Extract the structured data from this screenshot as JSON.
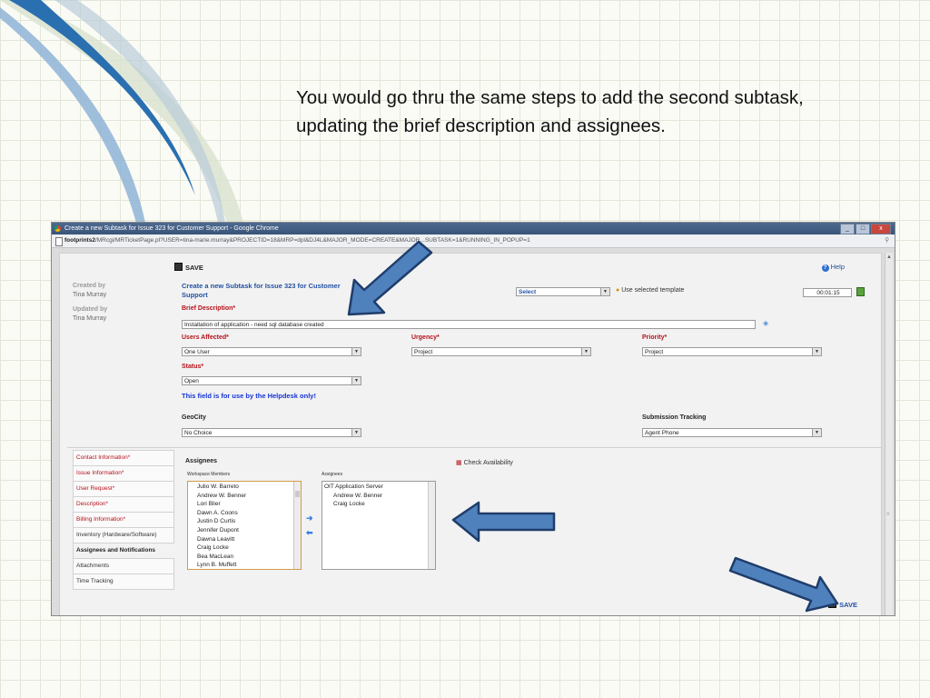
{
  "caption": "You would go thru the same steps to add the second subtask, updating the brief description and assignees.",
  "window": {
    "title": "Create a new Subtask for Issue 323 for Customer Support - Google Chrome",
    "url_host": "footprints2",
    "url_path": "/MRcgi/MRTicketPage.pl?USER=tina-marie.murray&PROJECTID=18&MRP=dpl&DJ4L&MAJOR_MODE=CREATE&MAJOR...SUBTASK=1&RUNNING_IN_POPUP=1",
    "buttons": [
      "_",
      "□",
      "x"
    ]
  },
  "toolbar": {
    "save_label": "SAVE",
    "help_label": "Help"
  },
  "meta": {
    "created_by_label": "Created by",
    "created_by": "Tina Murray",
    "updated_by_label": "Updated by",
    "updated_by": "Tina Murray"
  },
  "form": {
    "title": "Create a new Subtask for Issue 323 for Customer Support",
    "template_select": "Select",
    "use_template_label": "Use selected template",
    "timer": "00:01:15",
    "brief_description_label": "Brief Description*",
    "brief_description": "Installation of application - need sql database created",
    "users_affected_label": "Users Affected*",
    "users_affected": "One User",
    "urgency_label": "Urgency*",
    "urgency": "Project",
    "priority_label": "Priority*",
    "priority": "Project",
    "status_label": "Status*",
    "status": "Open",
    "helpdesk_note": "This field is for use by the Helpdesk only!",
    "geocity_label": "GeoCity",
    "geocity": "No Choice",
    "submission_tracking_label": "Submission Tracking",
    "submission_tracking": "Agent Phone"
  },
  "nav": [
    "Contact Information*",
    "Issue Information*",
    "User Request*",
    "Description*",
    "Billing Information*",
    "Inventory (Hardware/Software)",
    "Assignees and Notifications",
    "Attachments",
    "Time Tracking"
  ],
  "assignees": {
    "heading": "Assignees",
    "check_availability": "Check Availability",
    "workspace_members_label": "Workspace Members",
    "assignees_label": "Assignees",
    "workspace_members": [
      "Julio W. Barreto",
      "Andrew W. Benner",
      "Lori Blier",
      "Dawn A. Coons",
      "Justin D Curtis",
      "Jennifer Dupont",
      "Dawna Leavitt",
      "Craig Locke",
      "Bea MacLean",
      "Lynn B. Muffett"
    ],
    "assigned": [
      "OIT Application Server",
      "Andrew W. Benner",
      "Craig Locke"
    ]
  },
  "colors": {
    "arrow_fill": "#4f81bd",
    "arrow_stroke": "#1f3d6b",
    "required_red": "#b4121b",
    "link_blue": "#2452a4"
  }
}
